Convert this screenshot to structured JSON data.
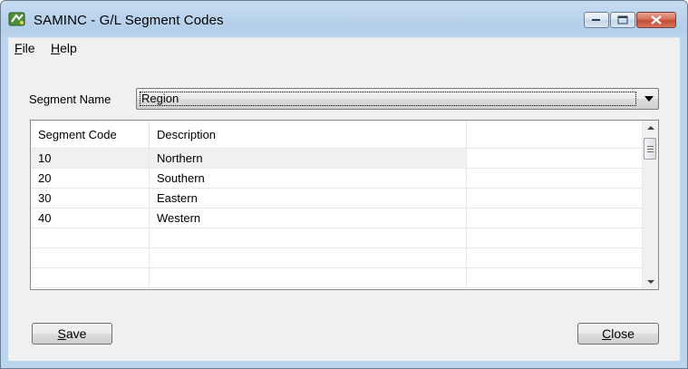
{
  "window": {
    "title": "SAMINC - G/L Segment Codes"
  },
  "menu": {
    "items": [
      {
        "label": "File",
        "accel": "F",
        "rest": "ile"
      },
      {
        "label": "Help",
        "accel": "H",
        "rest": "elp"
      }
    ]
  },
  "segment": {
    "label": "Segment Name",
    "value": "Region"
  },
  "grid": {
    "columns": [
      "Segment Code",
      "Description",
      ""
    ],
    "rows": [
      {
        "code": "10",
        "description": "Northern"
      },
      {
        "code": "20",
        "description": "Southern"
      },
      {
        "code": "30",
        "description": "Eastern"
      },
      {
        "code": "40",
        "description": "Western"
      },
      {
        "code": "",
        "description": ""
      },
      {
        "code": "",
        "description": ""
      },
      {
        "code": "",
        "description": ""
      }
    ]
  },
  "buttons": {
    "save": {
      "label": "Save",
      "accel": "S",
      "rest": "ave"
    },
    "close": {
      "label": "Close",
      "accel": "C",
      "rest": "lose"
    }
  }
}
